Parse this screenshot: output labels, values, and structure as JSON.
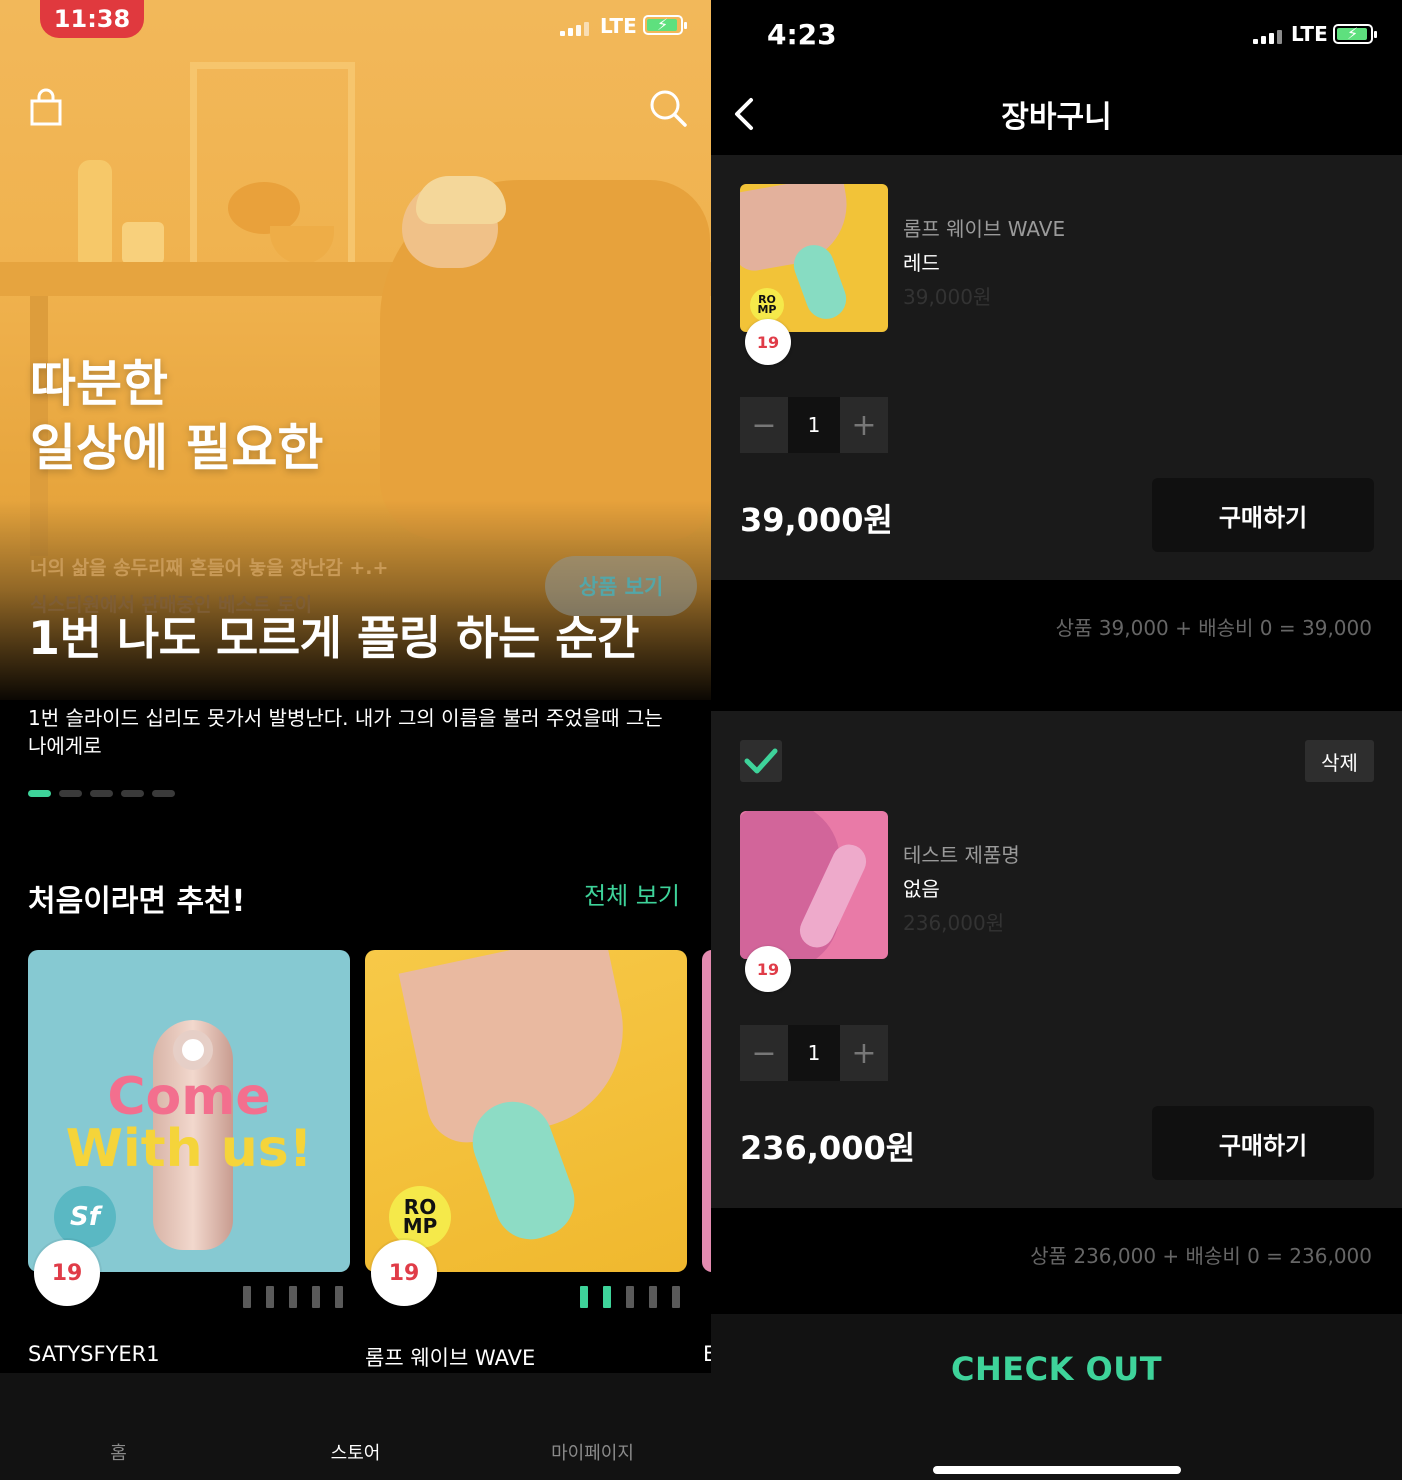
{
  "left": {
    "status": {
      "time": "11:38",
      "network": "LTE"
    },
    "hero": {
      "title_line1": "따분한",
      "title_line2": "일상에 필요한",
      "sub1": "너의 삶을 송두리째 흔들어 놓을 장난감 +.+",
      "sub2": "식스티원에서 판매중인 베스트 토이",
      "view_button": "상품 보기",
      "slide_title": "1번 나도 모르게 플링 하는 순간",
      "slide_desc": "1번 슬라이드 십리도 못가서 발병난다. 내가 그의 이름을 불러 주었을때 그는 나에게로",
      "slide_count": 5,
      "active_slide": 1
    },
    "section": {
      "title": "처음이라면 추천!",
      "link": "전체 보기"
    },
    "products": [
      {
        "name": "SATYSFYER1",
        "overlay_line1": "Come",
        "overlay_line2": "With us!",
        "brand_badge": "Sf",
        "age": "19",
        "images": 5,
        "active_image": 0
      },
      {
        "name": "롬프 웨이브 WAVE",
        "brand_badge": "RO MP",
        "age": "19",
        "images": 5,
        "active_image": 2
      },
      {
        "name": "E"
      }
    ],
    "tabs": [
      {
        "label": "홈",
        "active": false
      },
      {
        "label": "스토어",
        "active": true
      },
      {
        "label": "마이페이지",
        "active": false
      }
    ],
    "colors": {
      "accent": "#3ed39a",
      "hero_bg": "#f0b24e",
      "age_badge": "#e03c48"
    }
  },
  "right": {
    "status": {
      "time": "4:23",
      "network": "LTE"
    },
    "header": {
      "title": "장바구니",
      "back_icon": "chevron-left-icon"
    },
    "items": [
      {
        "name": "롬프 웨이브 WAVE",
        "option": "레드",
        "price": "39,000원",
        "qty": "1",
        "total": "39,000원",
        "buy": "구매하기",
        "summary": "상품 39,000 + 배송비 0 = 39,000",
        "brand_badge": "RO MP",
        "age": "19"
      },
      {
        "name": "테스트 제품명",
        "option": "없음",
        "price": "236,000원",
        "qty": "1",
        "total": "236,000원",
        "buy": "구매하기",
        "summary": "상품 236,000 + 배송비 0 = 236,000",
        "delete": "삭제",
        "checked": true,
        "age": "19"
      }
    ],
    "checkout": "CHECK OUT"
  }
}
